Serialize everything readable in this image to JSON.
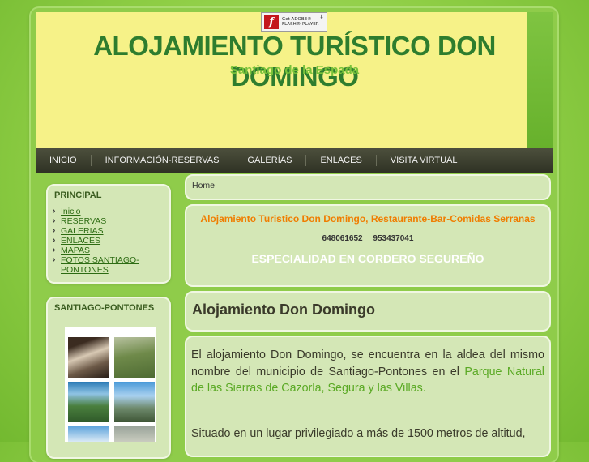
{
  "header": {
    "title": "ALOJAMIENTO TURÍSTICO DON DOMINGO",
    "subtitle": "Santiago de la Espada",
    "flash_badge": {
      "line1": "Get ADOBE®",
      "line2": "FLASH® PLAYER",
      "logo": "f"
    }
  },
  "nav": {
    "items": [
      "INICIO",
      "INFORMACIÓN-RESERVAS",
      "GALERÍAS",
      "ENLACES",
      "VISITA VIRTUAL"
    ]
  },
  "sidebar": {
    "principal_title": "PRINCIPAL",
    "menu": [
      "Inicio",
      "RESERVAS",
      "GALERIAS",
      "ENLACES",
      "MAPAS",
      "FOTOS SANTIAGO-",
      "PONTONES"
    ],
    "santiago_title": "SANTIAGO-PONTONES"
  },
  "main": {
    "breadcrumb": "Home",
    "promo": {
      "headline": "Alojamiento Turistico Don Domingo, Restaurante-Bar-Comidas Serranas",
      "phones": "648061652 953437041",
      "specialty": "ESPECIALIDAD EN CORDERO SEGUREÑO"
    },
    "article": {
      "title": "Alojamiento Don Domingo",
      "para1_before": "El alojamiento Don Domingo, se encuentra en la aldea del mismo nombre del municipio de Santiago-Pontones en el ",
      "para1_link": "Parque Natural de las Sierras de Cazorla, Segura y las Villas.",
      "para2": "Situado en un lugar privilegiado a más de 1500 metros de altitud,"
    }
  },
  "colors": {
    "title_green": "#2e7d2e",
    "subtitle_green": "#78c23a",
    "header_yellow": "#f6f288",
    "promo_orange": "#f07d00",
    "link_green": "#5aa924"
  }
}
